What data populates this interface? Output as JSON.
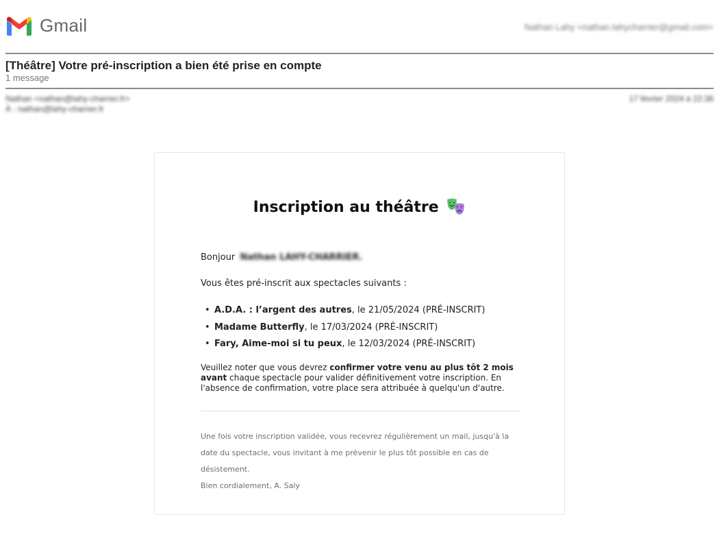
{
  "header": {
    "app_name": "Gmail",
    "account": "Nathan Lahy <nathan.lahycharrier@gmail.com>"
  },
  "thread": {
    "subject": "[Théâtre] Votre pré-inscription a bien été prise en compte",
    "count": "1 message"
  },
  "message": {
    "from": "Nathan <nathan@lahy-charrier.fr>",
    "to": "À : nathan@lahy-charrier.fr",
    "date": "17 février 2024 à 22:36"
  },
  "email": {
    "title": "Inscription au théâtre",
    "title_icon": "theater-masks-icon",
    "greeting": "Bonjour",
    "recipient_name": "Nathan LAHY-CHARRIER.",
    "intro": "Vous êtes pré-inscrit aux spectacles suivants :",
    "shows": [
      {
        "name": "A.D.A. : l’argent des autres",
        "details": ", le 21/05/2024 (PRÉ-INSCRIT)"
      },
      {
        "name": "Madame Butterfly",
        "details": ", le 17/03/2024 (PRÉ-INSCRIT)"
      },
      {
        "name": "Fary, Aime-moi si tu peux",
        "details": ", le 12/03/2024 (PRÉ-INSCRIT)"
      }
    ],
    "note_prefix": "Veuillez noter que vous devrez ",
    "note_bold": "confirmer votre venu au plus tôt 2 mois avant",
    "note_suffix": " chaque spectacle pour valider définitivement votre inscription. En l'absence de confirmation, votre place sera attribuée à quelqu'un d'autre.",
    "footer_line1": "Une fois votre inscription validée, vous recevrez régulièrement un mail, jusqu'à la date du spectacle, vous invitant à me prévenir le plus tôt possible en cas de désistement.",
    "footer_line2": "Bien cordialement, A. Saly"
  },
  "colors": {
    "gmail_red": "#EA4335",
    "gmail_blue": "#4285F4",
    "gmail_green": "#34A853",
    "gmail_yellow": "#FBBC04",
    "mask_green": "#5cbf6a",
    "mask_purple": "#a77fd6"
  }
}
